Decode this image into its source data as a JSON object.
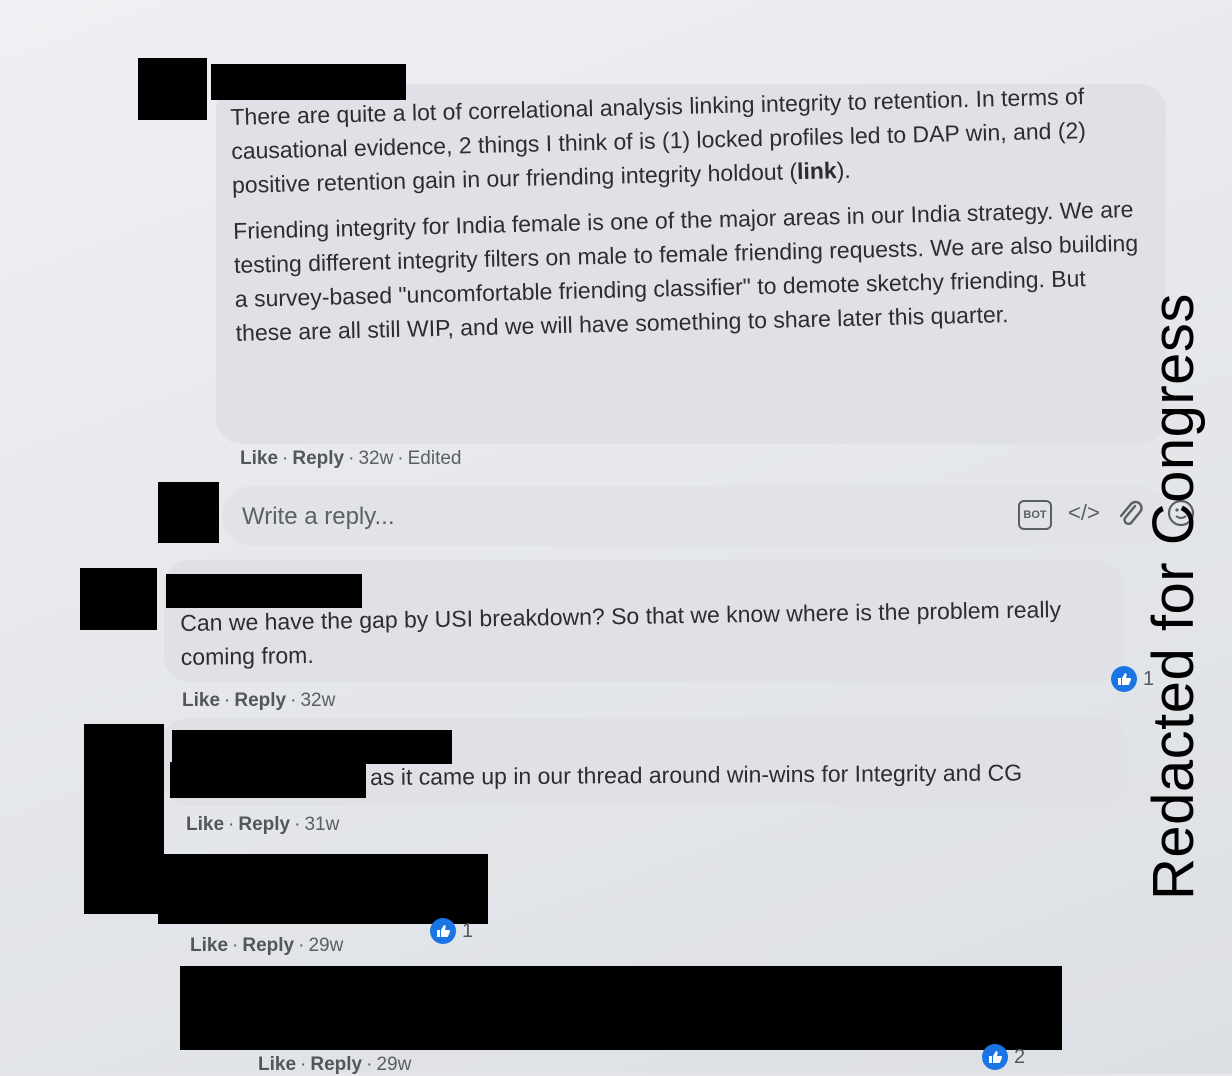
{
  "comments": [
    {
      "paragraph1_before_link": "There are quite a lot of correlational analysis linking integrity to retention. In terms of causational evidence, 2 things I think of is (1) locked profiles led to DAP win, and (2) positive retention gain in our friending integrity holdout (",
      "link_text": "link",
      "paragraph1_after_link": ").",
      "paragraph2": "Friending integrity for India female is one of the major areas in our India strategy. We are testing different integrity filters on male to female friending requests. We are also building a survey-based \"uncomfortable friending classifier\" to demote sketchy friending. But these are all still WIP, and we will have something to share later this quarter.",
      "like_label": "Like",
      "reply_label": "Reply",
      "time": "32w",
      "edited": "Edited"
    },
    {
      "text": "Can we have the gap by USI breakdown? So that we know where is the problem really coming from.",
      "like_label": "Like",
      "reply_label": "Reply",
      "time": "32w",
      "reaction_count": "1"
    },
    {
      "text": "as it came up in our thread around win-wins for Integrity and CG",
      "like_label": "Like",
      "reply_label": "Reply",
      "time": "31w"
    },
    {
      "like_label": "Like",
      "reply_label": "Reply",
      "time": "29w",
      "reaction_count": "1"
    },
    {
      "like_label": "Like",
      "reply_label": "Reply",
      "time": "29w",
      "reaction_count": "2"
    }
  ],
  "reply_box": {
    "placeholder": "Write a reply...",
    "icons": {
      "bot": "bot-icon",
      "code": "code-icon",
      "attach": "paperclip-icon",
      "emoji": "emoji-icon"
    },
    "bot_label": "BOT",
    "code_glyph": "</>"
  },
  "separator": "·",
  "watermark": "Redacted for Congress",
  "colors": {
    "like_badge": "#1b74e4",
    "redaction": "#000000"
  }
}
